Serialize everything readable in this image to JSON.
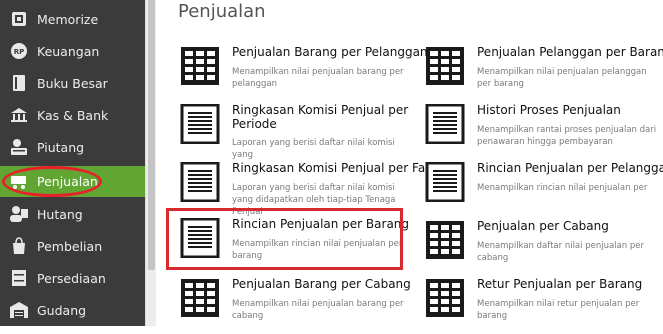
{
  "sidebar": {
    "items": [
      {
        "label": "Memorize",
        "icon": "memorize-icon"
      },
      {
        "label": "Keuangan",
        "icon": "rp-coin-icon"
      },
      {
        "label": "Buku Besar",
        "icon": "ledger-book-icon"
      },
      {
        "label": "Kas & Bank",
        "icon": "bank-icon"
      },
      {
        "label": "Piutang",
        "icon": "receivable-icon"
      },
      {
        "label": "Penjualan",
        "icon": "cart-icon",
        "active": true
      },
      {
        "label": "Hutang",
        "icon": "payable-icon"
      },
      {
        "label": "Pembelian",
        "icon": "purchase-icon"
      },
      {
        "label": "Persediaan",
        "icon": "inventory-icon"
      },
      {
        "label": "Gudang",
        "icon": "warehouse-icon"
      }
    ],
    "active_color": "#61a632"
  },
  "main": {
    "title": "Penjualan",
    "reports": [
      {
        "title": "Penjualan Barang per Pelanggan",
        "desc": "Menampilkan nilai penjualan barang per pelanggan",
        "icon": "grid-icon"
      },
      {
        "title": "Penjualan Pelanggan per Barang",
        "desc": "Menampilkan nilai penjualan pelanggan per barang",
        "icon": "grid-icon"
      },
      {
        "title": "Ringkasan Komisi Penjual per Periode",
        "desc": "Laporan yang berisi daftar nilai komisi yang",
        "icon": "document-icon"
      },
      {
        "title": "Histori Proses Penjualan",
        "desc": "Menampilkan rantai proses penjualan dari penawaran hingga pembayaran",
        "icon": "document-icon"
      },
      {
        "title": "Ringkasan Komisi Penjual per Faktur",
        "desc": "Laporan yang berisi daftar nilai komisi yang didapatkan oleh tiap-tiap Tenaga Penjual",
        "icon": "document-icon"
      },
      {
        "title": "Rincian Penjualan per Pelanggan",
        "desc": "Menampilkan rincian nilai penjualan per",
        "icon": "document-icon"
      },
      {
        "title": "Rincian Penjualan per Barang",
        "desc": "Menampilkan rincian nilai penjualan per barang",
        "icon": "document-icon"
      },
      {
        "title": "Penjualan per Cabang",
        "desc": "Menampilkan daftar nilai penjualan per cabang",
        "icon": "grid-icon"
      },
      {
        "title": "Penjualan Barang per Cabang",
        "desc": "Menampilkan nilai penjualan barang per cabang",
        "icon": "grid-icon"
      },
      {
        "title": "Retur Penjualan per Barang",
        "desc": "Menampilkan nilai retur penjualan per barang",
        "icon": "grid-icon"
      }
    ]
  },
  "annotations": {
    "highlight_color": "#d8292f"
  }
}
